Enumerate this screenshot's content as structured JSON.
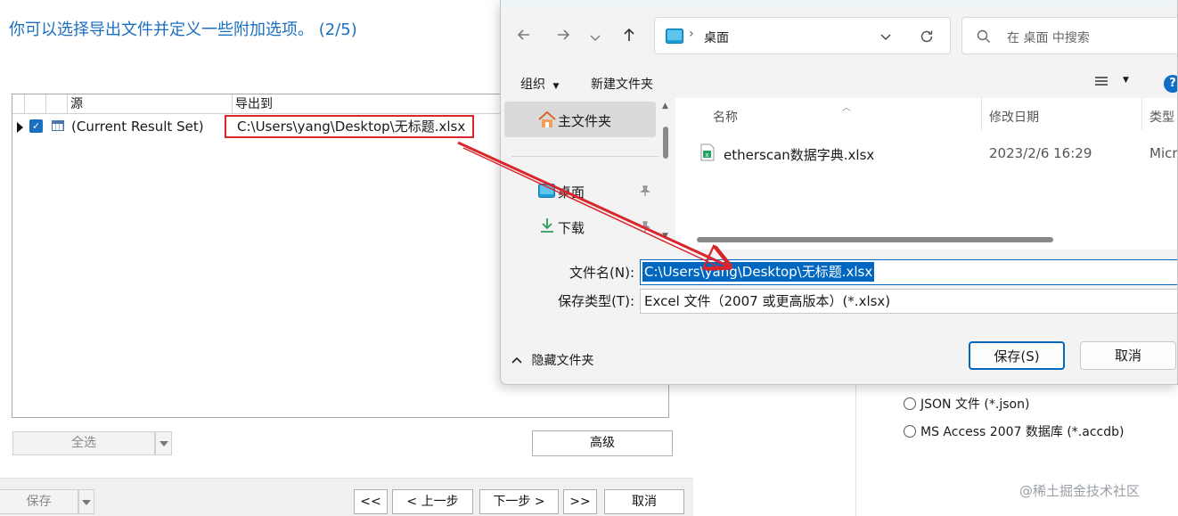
{
  "wizard": {
    "title": "你可以选择导出文件并定义一些附加选项。 (2/5)",
    "grid": {
      "columns": [
        "源",
        "导出到"
      ],
      "row": {
        "checked": true,
        "source": "(Current Result Set)",
        "destination": "C:\\Users\\yang\\Desktop\\无标题.xlsx"
      }
    },
    "select_all_label": "全选",
    "advanced_label": "高级",
    "save_label": "保存",
    "first_label": "<<",
    "prev_label": "< 上一步",
    "next_label": "下一步 >",
    "last_label": ">>",
    "cancel_label": "取消",
    "formats": [
      {
        "label": "JSON 文件 (*.json)",
        "selected": false
      },
      {
        "label": "MS Access 2007 数据库 (*.accdb)",
        "selected": false
      }
    ],
    "watermark": "@稀土掘金技术社区"
  },
  "dialog": {
    "address": {
      "location": "桌面"
    },
    "search_placeholder": "在 桌面 中搜索",
    "toolbar": {
      "organize": "组织",
      "new_folder": "新建文件夹"
    },
    "nav": [
      {
        "label": "主文件夹",
        "icon": "home-icon"
      },
      {
        "label": "桌面",
        "icon": "desktop-folder-icon"
      },
      {
        "label": "下载",
        "icon": "download-icon"
      }
    ],
    "columns": {
      "name": "名称",
      "modified": "修改日期",
      "type": "类型"
    },
    "files": [
      {
        "name": "etherscan数据字典.xlsx",
        "modified": "2023/2/6 16:29",
        "type": "Micr"
      }
    ],
    "filename_label": "文件名(N):",
    "filename_value": "C:\\Users\\yang\\Desktop\\无标题.xlsx",
    "filetype_label": "保存类型(T):",
    "filetype_value": "Excel 文件（2007 或更高版本）(*.xlsx)",
    "hide_folders_label": "隐藏文件夹",
    "save_button": "保存(S)",
    "cancel_button": "取消"
  },
  "colors": {
    "accent": "#0067c0",
    "title_blue": "#1a6fc0",
    "annotation_red": "#d9262c"
  }
}
